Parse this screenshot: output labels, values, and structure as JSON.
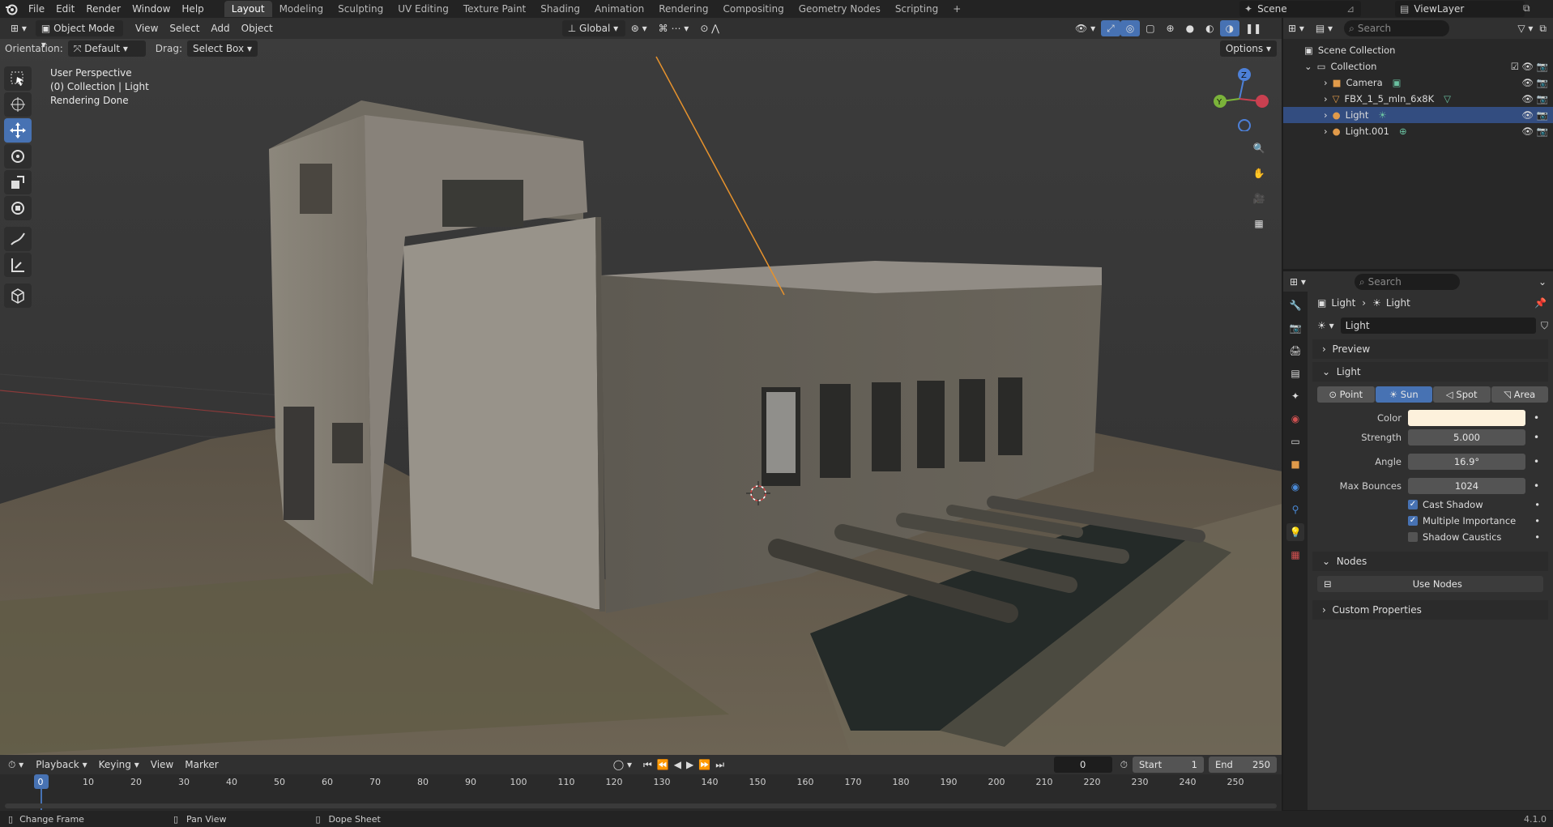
{
  "topbar": {
    "menus": [
      "File",
      "Edit",
      "Render",
      "Window",
      "Help"
    ],
    "workspaces": [
      "Layout",
      "Modeling",
      "Sculpting",
      "UV Editing",
      "Texture Paint",
      "Shading",
      "Animation",
      "Rendering",
      "Compositing",
      "Geometry Nodes",
      "Scripting"
    ],
    "active_workspace": "Layout",
    "add_tab": "+",
    "scene": "Scene",
    "view_layer": "ViewLayer"
  },
  "viewport_header": {
    "mode": "Object Mode",
    "menus": [
      "View",
      "Select",
      "Add",
      "Object"
    ],
    "transform_orientation": "Global",
    "orientation_label": "Orientation:",
    "orientation_value": "Default",
    "drag_label": "Drag:",
    "drag_value": "Select Box",
    "options": "Options"
  },
  "viewport_overlay": {
    "line1": "User Perspective",
    "line2": "(0) Collection | Light",
    "line3": "Rendering Done"
  },
  "gizmo": {
    "x": "X",
    "y": "Y",
    "z": "Z"
  },
  "outliner": {
    "search_placeholder": "Search",
    "root": "Scene Collection",
    "collection": "Collection",
    "items": [
      {
        "name": "Camera",
        "selected": false
      },
      {
        "name": "FBX_1_5_mln_6x8K",
        "selected": false
      },
      {
        "name": "Light",
        "selected": true
      },
      {
        "name": "Light.001",
        "selected": false
      }
    ]
  },
  "properties": {
    "search_placeholder": "Search",
    "breadcrumb": [
      "Light",
      "Light"
    ],
    "datablock": "Light",
    "sections": {
      "preview": "Preview",
      "light": "Light",
      "nodes": "Nodes",
      "custom": "Custom Properties"
    },
    "light_types": [
      "Point",
      "Sun",
      "Spot",
      "Area"
    ],
    "active_type": "Sun",
    "color_label": "Color",
    "color_value": "#fdf1dc",
    "strength_label": "Strength",
    "strength": "5.000",
    "angle_label": "Angle",
    "angle": "16.9°",
    "bounces_label": "Max Bounces",
    "bounces": "1024",
    "cast_shadow": "Cast Shadow",
    "multiple_importance": "Multiple Importance",
    "shadow_caustics": "Shadow Caustics",
    "use_nodes": "Use Nodes"
  },
  "timeline": {
    "menus": [
      "Playback",
      "Keying",
      "View",
      "Marker"
    ],
    "current_frame": "0",
    "start_label": "Start",
    "start": "1",
    "end_label": "End",
    "end": "250",
    "ruler": [
      "0",
      "10",
      "20",
      "30",
      "40",
      "50",
      "60",
      "70",
      "80",
      "90",
      "100",
      "110",
      "120",
      "130",
      "140",
      "150",
      "160",
      "170",
      "180",
      "190",
      "200",
      "210",
      "220",
      "230",
      "240",
      "250"
    ]
  },
  "statusbar": {
    "left": "Change Frame",
    "middle": "Pan View",
    "right": "Dope Sheet",
    "version": "4.1.0"
  },
  "colors": {
    "accent": "#4772b3",
    "selected_row": "#334d80",
    "light_color": "#fdf1dc"
  }
}
